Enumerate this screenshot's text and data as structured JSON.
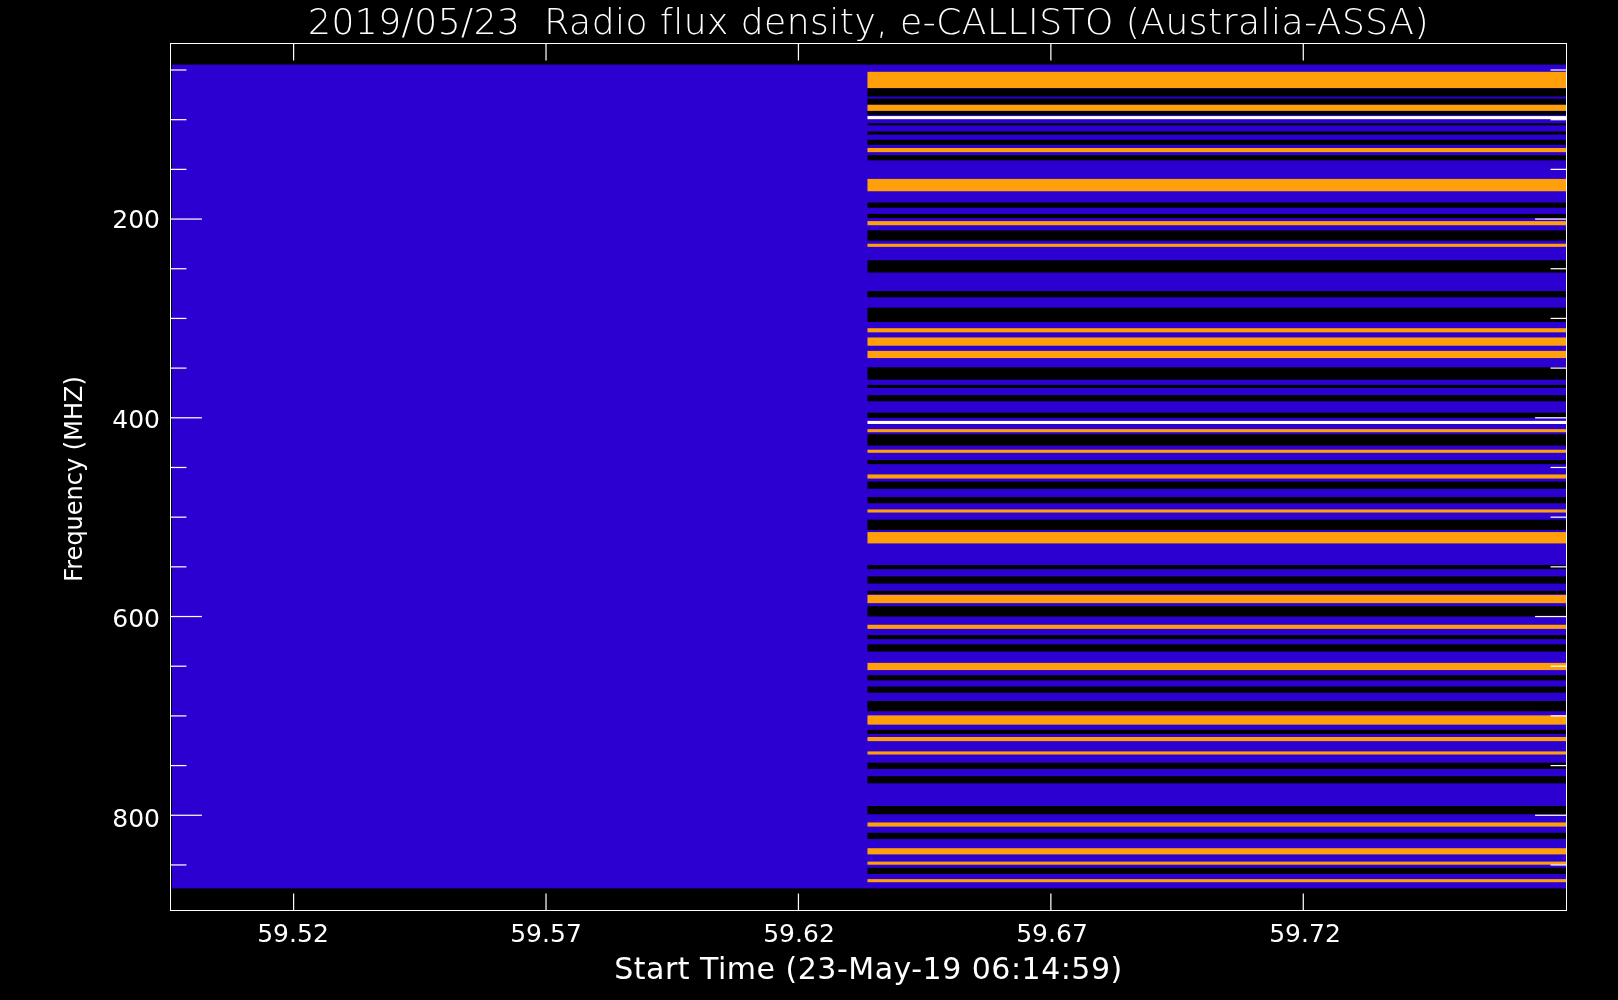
{
  "title": "2019/05/23  Radio flux density, e-CALLISTO (Australia-ASSA)",
  "y_axis": {
    "label": "Frequency (MHZ)",
    "ticks": [
      "200",
      "400",
      "600",
      "800"
    ]
  },
  "x_axis": {
    "label": "Start Time (23-May-19 06:14:59)",
    "ticks": [
      "59.52",
      "59.57",
      "59.62",
      "59.67",
      "59.72"
    ]
  }
}
